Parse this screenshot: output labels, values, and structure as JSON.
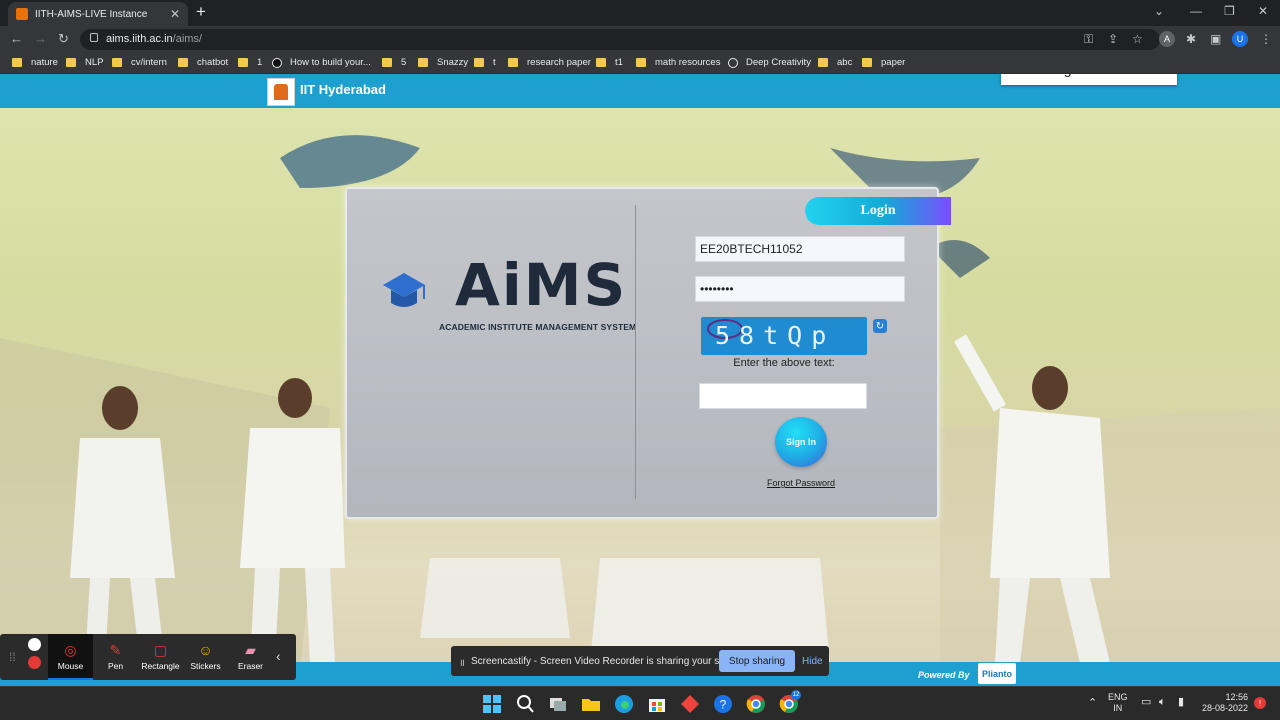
{
  "browser": {
    "tab_title": "IITH-AIMS-LIVE Instance",
    "url_host": "aims.iith.ac.in",
    "url_path": "/aims/",
    "profile_letter_a": "A",
    "profile_letter_u": "U"
  },
  "bookmarks": [
    {
      "label": "nature",
      "icon": "folder"
    },
    {
      "label": "NLP",
      "icon": "folder"
    },
    {
      "label": "cv/intern",
      "icon": "folder"
    },
    {
      "label": "chatbot",
      "icon": "folder"
    },
    {
      "label": "1",
      "icon": "folder"
    },
    {
      "label": "How to build your...",
      "icon": "site"
    },
    {
      "label": "5",
      "icon": "folder"
    },
    {
      "label": "Snazzy",
      "icon": "folder"
    },
    {
      "label": "t",
      "icon": "folder"
    },
    {
      "label": "research paper",
      "icon": "folder"
    },
    {
      "label": "t1",
      "icon": "folder"
    },
    {
      "label": "math resources",
      "icon": "folder"
    },
    {
      "label": "Deep Creativity",
      "icon": "globe"
    },
    {
      "label": "abc",
      "icon": "folder"
    },
    {
      "label": "paper",
      "icon": "folder"
    }
  ],
  "header": {
    "institute_name": "IIT Hyderabad",
    "status_popup": "Running... Please wait"
  },
  "aims": {
    "wordmark": "AiMS",
    "subtitle": "ACADEMIC INSTITUTE MANAGEMENT SYSTEM"
  },
  "login": {
    "tab_label": "Login",
    "username_value": "EE20BTECH11052",
    "password_value": "••••••••",
    "captcha_text": "58tQp",
    "captcha_prompt": "Enter the above text:",
    "captcha_input_value": "",
    "signin_label": "Sign In",
    "forgot_label": "Forgot Password"
  },
  "footer": {
    "powered_by": "Powered By",
    "vendor": "Plianto"
  },
  "screencastify": {
    "tools": [
      {
        "label": "Mouse",
        "active": true
      },
      {
        "label": "Pen",
        "active": false
      },
      {
        "label": "Rectangle",
        "active": false
      },
      {
        "label": "Stickers",
        "active": false
      },
      {
        "label": "Eraser",
        "active": false
      }
    ],
    "share_message": "Screencastify - Screen Video Recorder is sharing your screen.",
    "stop_label": "Stop sharing",
    "hide_label": "Hide"
  },
  "taskbar": {
    "lang_top": "ENG",
    "lang_bottom": "IN",
    "time": "12:56",
    "date": "28-08-2022",
    "chrome_badge": "12"
  },
  "colors": {
    "brand_blue": "#1da0cf",
    "captcha_bg": "#1f8bd0"
  }
}
